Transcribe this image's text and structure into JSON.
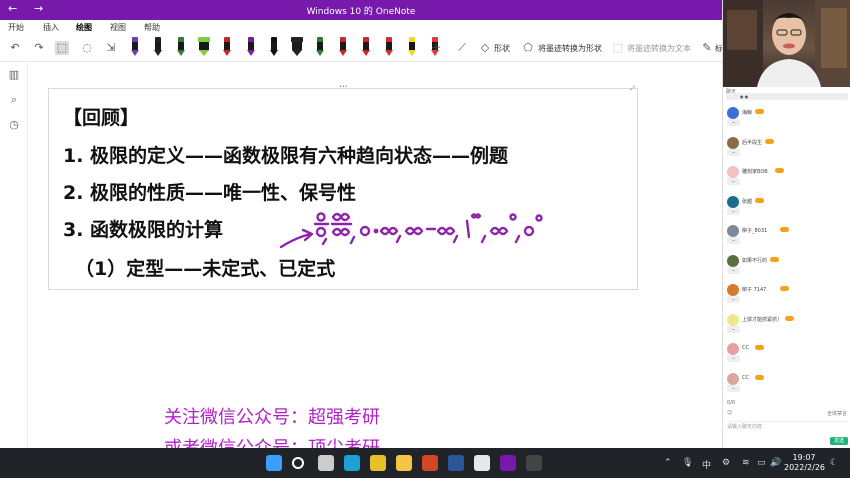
{
  "window": {
    "title": "Windows 10 的 OneNote",
    "accent": "#7719aa",
    "back_glyph": "←",
    "forward_glyph": "→"
  },
  "ribbon": {
    "tabs": [
      {
        "label": "开始",
        "active": false
      },
      {
        "label": "插入",
        "active": false
      },
      {
        "label": "绘图",
        "active": true
      },
      {
        "label": "视图",
        "active": false
      },
      {
        "label": "帮助",
        "active": false
      }
    ],
    "shapes_label": "形状",
    "ink_to_shape_label": "将墨迹转换为形状",
    "ink_to_text_label": "将墨迹转换为文本",
    "truncated_label": "标",
    "pens": [
      {
        "band": "#6a3fb5"
      },
      {
        "band": "#222222"
      },
      {
        "band": "#2e7d32"
      },
      {
        "band": "#7ecf3d",
        "wide": true
      },
      {
        "band": "#c62828"
      },
      {
        "band": "#7b1fa2"
      },
      {
        "band": "#111111"
      },
      {
        "band": "#222222",
        "wide": true
      },
      {
        "band": "#2e7d32"
      },
      {
        "band": "#c62828"
      },
      {
        "band": "#c62828"
      },
      {
        "band": "#d32f2f"
      },
      {
        "band": "#f9d71c"
      },
      {
        "band": "#e53935"
      }
    ]
  },
  "page": {
    "lines": [
      "【回顾】",
      "1. 极限的定义——函数极限有六种趋向状态——例题",
      "2. 极限的性质——唯一性、保号性",
      "3. 函数极限的计算",
      "（1）定型——未定式、已定式"
    ],
    "ink_color": "#8e24aa",
    "watermark_lines": [
      "关注微信公众号：超强考研",
      "或者微信公众号：顶尖考研"
    ],
    "watermark_color": "#b021c9"
  },
  "chat": {
    "users": [
      {
        "name": "海鲸",
        "color": "#3c6fd6"
      },
      {
        "name": "后半段生",
        "color": "#8b6a4a"
      },
      {
        "name": "雕刻家BOB",
        "color": "#f2c1c1"
      },
      {
        "name": "张越",
        "color": "#1b6e8c"
      },
      {
        "name": "柳子_8031",
        "color": "#7c8b9a"
      },
      {
        "name": "如果不行的",
        "color": "#5a6f3f"
      },
      {
        "name": "柳子 7147",
        "color": "#d87a2b"
      },
      {
        "name": "上岸才能抓紧抓！",
        "color": "#f0e68c"
      },
      {
        "name": "CC",
        "color": "#e6a0a0"
      },
      {
        "name": "CC",
        "color": "#d9a7a0"
      }
    ],
    "count": "0/0",
    "footer_right": "全体禁言",
    "input_placeholder": "请输入聊天内容",
    "send_label": "发送"
  },
  "taskbar": {
    "time": "19:07",
    "date": "2022/2/26",
    "ime": "中",
    "apps": [
      {
        "name": "start",
        "color": "#3aa0ff"
      },
      {
        "name": "search",
        "color": "#ffffff"
      },
      {
        "name": "task-view",
        "color": "#cccccc"
      },
      {
        "name": "edge",
        "color": "#1ba3d6"
      },
      {
        "name": "chrome",
        "color": "#e6c229"
      },
      {
        "name": "explorer",
        "color": "#f4c542"
      },
      {
        "name": "powerpoint",
        "color": "#d24726"
      },
      {
        "name": "word",
        "color": "#2b579a"
      },
      {
        "name": "app",
        "color": "#e8e8e8"
      },
      {
        "name": "onenote",
        "color": "#7719aa"
      },
      {
        "name": "app2",
        "color": "#444444"
      }
    ]
  }
}
